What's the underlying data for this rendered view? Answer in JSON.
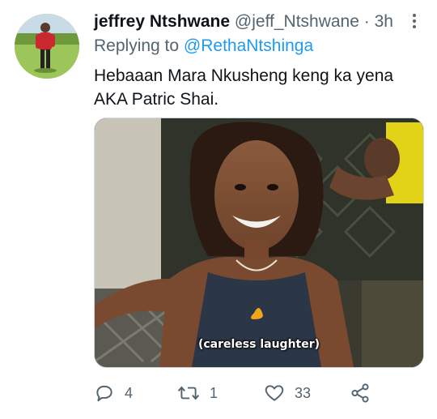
{
  "tweet": {
    "author_name": "jeffrey Ntshwane",
    "handle": "@jeff_Ntshwane",
    "separator": "·",
    "time": "3h",
    "replying_prefix": "Replying to",
    "replying_to": "@RethaNtshinga",
    "text": "Hebaaan Mara Nkusheng keng ka yena AKA Patric Shai.",
    "media_caption": "(careless laughter)"
  },
  "actions": {
    "reply_count": "4",
    "retweet_count": "1",
    "like_count": "33"
  },
  "icons": {
    "more": "more-dots-icon",
    "reply": "reply-bubble-icon",
    "retweet": "retweet-arrows-icon",
    "like": "heart-icon",
    "share": "share-nodes-icon"
  },
  "colors": {
    "name": "#0f1419",
    "secondary": "#536471",
    "mention": "#1d9bf0"
  }
}
